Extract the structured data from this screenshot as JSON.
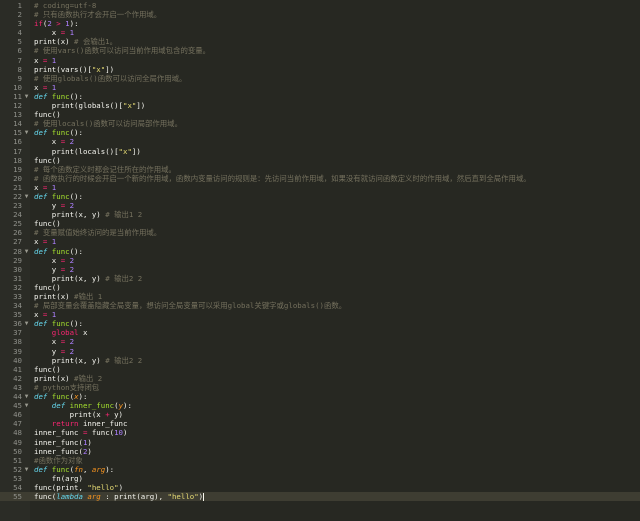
{
  "lines": [
    {
      "n": "1",
      "fold": "",
      "current": false,
      "t": [
        [
          "cm",
          "# coding=utf-8"
        ]
      ]
    },
    {
      "n": "2",
      "fold": "",
      "current": false,
      "t": [
        [
          "cm",
          "# 只有函数执行才会开启一个作用域。"
        ]
      ]
    },
    {
      "n": "3",
      "fold": "",
      "current": false,
      "t": [
        [
          "kw",
          "if"
        ],
        [
          "",
          "("
        ],
        [
          "nb",
          "2"
        ],
        [
          "kw",
          " > "
        ],
        [
          "nb",
          "1"
        ],
        [
          "",
          "):"
        ]
      ]
    },
    {
      "n": "4",
      "fold": "",
      "current": false,
      "t": [
        [
          "",
          "    x "
        ],
        [
          "kw",
          "="
        ],
        [
          "nb",
          " 1"
        ]
      ]
    },
    {
      "n": "5",
      "fold": "",
      "current": false,
      "t": [
        [
          "",
          "print(x) "
        ],
        [
          "cm",
          "# 会输出1。"
        ]
      ]
    },
    {
      "n": "6",
      "fold": "",
      "current": false,
      "t": [
        [
          "cm",
          "# 使用vars()函数可以访问当前作用域包含的变量。"
        ]
      ]
    },
    {
      "n": "7",
      "fold": "",
      "current": false,
      "t": [
        [
          "",
          "x "
        ],
        [
          "kw",
          "="
        ],
        [
          "nb",
          " 1"
        ]
      ]
    },
    {
      "n": "8",
      "fold": "",
      "current": false,
      "t": [
        [
          "",
          "print(vars()["
        ],
        [
          "st",
          "\"x\""
        ],
        [
          "",
          "])"
        ]
      ]
    },
    {
      "n": "9",
      "fold": "",
      "current": false,
      "t": [
        [
          "cm",
          "# 使用globals()函数可以访问全局作用域。"
        ]
      ]
    },
    {
      "n": "10",
      "fold": "",
      "current": false,
      "t": [
        [
          "",
          "x "
        ],
        [
          "kw",
          "="
        ],
        [
          "nb",
          " 1"
        ]
      ]
    },
    {
      "n": "11",
      "fold": "▼",
      "current": false,
      "t": [
        [
          "df",
          "def"
        ],
        [
          "fn",
          " func"
        ],
        [
          "",
          "():"
        ]
      ]
    },
    {
      "n": "12",
      "fold": "",
      "current": false,
      "t": [
        [
          "",
          "    print(globals()["
        ],
        [
          "st",
          "\"x\""
        ],
        [
          "",
          "])"
        ]
      ]
    },
    {
      "n": "13",
      "fold": "",
      "current": false,
      "t": [
        [
          "",
          "func()"
        ]
      ]
    },
    {
      "n": "14",
      "fold": "",
      "current": false,
      "t": [
        [
          "cm",
          "# 使用locals()函数可以访问局部作用域。"
        ]
      ]
    },
    {
      "n": "15",
      "fold": "▼",
      "current": false,
      "t": [
        [
          "df",
          "def"
        ],
        [
          "fn",
          " func"
        ],
        [
          "",
          "():"
        ]
      ]
    },
    {
      "n": "16",
      "fold": "",
      "current": false,
      "t": [
        [
          "",
          "    x "
        ],
        [
          "kw",
          "="
        ],
        [
          "nb",
          " 2"
        ]
      ]
    },
    {
      "n": "17",
      "fold": "",
      "current": false,
      "t": [
        [
          "",
          "    print(locals()["
        ],
        [
          "st",
          "\"x\""
        ],
        [
          "",
          "])"
        ]
      ]
    },
    {
      "n": "18",
      "fold": "",
      "current": false,
      "t": [
        [
          "",
          "func()"
        ]
      ]
    },
    {
      "n": "19",
      "fold": "",
      "current": false,
      "t": [
        [
          "cm",
          "# 每个函数定义时都会记住所在的作用域。"
        ]
      ]
    },
    {
      "n": "20",
      "fold": "",
      "current": false,
      "t": [
        [
          "cm",
          "# 函数执行的时候会开启一个新的作用域，函数内变量访问的规则是：先访问当前作用域，如果没有就访问函数定义时的作用域，然后直到全局作用域。"
        ]
      ]
    },
    {
      "n": "21",
      "fold": "",
      "current": false,
      "t": [
        [
          "",
          "x "
        ],
        [
          "kw",
          "="
        ],
        [
          "nb",
          " 1"
        ]
      ]
    },
    {
      "n": "22",
      "fold": "▼",
      "current": false,
      "t": [
        [
          "df",
          "def"
        ],
        [
          "fn",
          " func"
        ],
        [
          "",
          "():"
        ]
      ]
    },
    {
      "n": "23",
      "fold": "",
      "current": false,
      "t": [
        [
          "",
          "    y "
        ],
        [
          "kw",
          "="
        ],
        [
          "nb",
          " 2"
        ]
      ]
    },
    {
      "n": "24",
      "fold": "",
      "current": false,
      "t": [
        [
          "",
          "    print(x, y) "
        ],
        [
          "cm",
          "# 输出1 2"
        ]
      ]
    },
    {
      "n": "25",
      "fold": "",
      "current": false,
      "t": [
        [
          "",
          "func()"
        ]
      ]
    },
    {
      "n": "26",
      "fold": "",
      "current": false,
      "t": [
        [
          "cm",
          "# 变量赋值始终访问的是当前作用域。"
        ]
      ]
    },
    {
      "n": "27",
      "fold": "",
      "current": false,
      "t": [
        [
          "",
          "x "
        ],
        [
          "kw",
          "="
        ],
        [
          "nb",
          " 1"
        ]
      ]
    },
    {
      "n": "28",
      "fold": "▼",
      "current": false,
      "t": [
        [
          "df",
          "def"
        ],
        [
          "fn",
          " func"
        ],
        [
          "",
          "():"
        ]
      ]
    },
    {
      "n": "29",
      "fold": "",
      "current": false,
      "t": [
        [
          "",
          "    x "
        ],
        [
          "kw",
          "="
        ],
        [
          "nb",
          " 2"
        ]
      ]
    },
    {
      "n": "30",
      "fold": "",
      "current": false,
      "t": [
        [
          "",
          "    y "
        ],
        [
          "kw",
          "="
        ],
        [
          "nb",
          " 2"
        ]
      ]
    },
    {
      "n": "31",
      "fold": "",
      "current": false,
      "t": [
        [
          "",
          "    print(x, y) "
        ],
        [
          "cm",
          "# 输出2 2"
        ]
      ]
    },
    {
      "n": "32",
      "fold": "",
      "current": false,
      "t": [
        [
          "",
          "func()"
        ]
      ]
    },
    {
      "n": "33",
      "fold": "",
      "current": false,
      "t": [
        [
          "",
          "print(x) "
        ],
        [
          "cm",
          "#输出 1"
        ]
      ]
    },
    {
      "n": "34",
      "fold": "",
      "current": false,
      "t": [
        [
          "cm",
          "# 局部变量会覆盖隐藏全局变量，想访问全局变量可以采用global关键字或globals()函数。"
        ]
      ]
    },
    {
      "n": "35",
      "fold": "",
      "current": false,
      "t": [
        [
          "",
          "x "
        ],
        [
          "kw",
          "="
        ],
        [
          "nb",
          " 1"
        ]
      ]
    },
    {
      "n": "36",
      "fold": "▼",
      "current": false,
      "t": [
        [
          "df",
          "def"
        ],
        [
          "fn",
          " func"
        ],
        [
          "",
          "():"
        ]
      ]
    },
    {
      "n": "37",
      "fold": "",
      "current": false,
      "t": [
        [
          "kw",
          "    global"
        ],
        [
          "",
          " x"
        ]
      ]
    },
    {
      "n": "38",
      "fold": "",
      "current": false,
      "t": [
        [
          "",
          "    x "
        ],
        [
          "kw",
          "="
        ],
        [
          "nb",
          " 2"
        ]
      ]
    },
    {
      "n": "39",
      "fold": "",
      "current": false,
      "t": [
        [
          "",
          "    y "
        ],
        [
          "kw",
          "="
        ],
        [
          "nb",
          " 2"
        ]
      ]
    },
    {
      "n": "40",
      "fold": "",
      "current": false,
      "t": [
        [
          "",
          "    print(x, y) "
        ],
        [
          "cm",
          "# 输出2 2"
        ]
      ]
    },
    {
      "n": "41",
      "fold": "",
      "current": false,
      "t": [
        [
          "",
          "func()"
        ]
      ]
    },
    {
      "n": "42",
      "fold": "",
      "current": false,
      "t": [
        [
          "",
          "print(x) "
        ],
        [
          "cm",
          "#输出 2"
        ]
      ]
    },
    {
      "n": "43",
      "fold": "",
      "current": false,
      "t": [
        [
          "cm",
          "# python支持闭包"
        ]
      ]
    },
    {
      "n": "44",
      "fold": "▼",
      "current": false,
      "t": [
        [
          "df",
          "def"
        ],
        [
          "fn",
          " func"
        ],
        [
          "",
          "("
        ],
        [
          "pa",
          "x"
        ],
        [
          "",
          "):"
        ]
      ]
    },
    {
      "n": "45",
      "fold": "▼",
      "current": false,
      "t": [
        [
          "df",
          "    def"
        ],
        [
          "fn",
          " inner_func"
        ],
        [
          "",
          "("
        ],
        [
          "pa",
          "y"
        ],
        [
          "",
          "):"
        ]
      ]
    },
    {
      "n": "46",
      "fold": "",
      "current": false,
      "t": [
        [
          "",
          "        print(x "
        ],
        [
          "kw",
          "+"
        ],
        [
          "",
          " y)"
        ]
      ]
    },
    {
      "n": "47",
      "fold": "",
      "current": false,
      "t": [
        [
          "kw",
          "    return"
        ],
        [
          "",
          " inner_func"
        ]
      ]
    },
    {
      "n": "48",
      "fold": "",
      "current": false,
      "t": [
        [
          "",
          "inner_func "
        ],
        [
          "kw",
          "="
        ],
        [
          "",
          " func("
        ],
        [
          "nb",
          "10"
        ],
        [
          "",
          ")"
        ]
      ]
    },
    {
      "n": "49",
      "fold": "",
      "current": false,
      "t": [
        [
          "",
          "inner_func("
        ],
        [
          "nb",
          "1"
        ],
        [
          "",
          ")"
        ]
      ]
    },
    {
      "n": "50",
      "fold": "",
      "current": false,
      "t": [
        [
          "",
          "inner_func("
        ],
        [
          "nb",
          "2"
        ],
        [
          "",
          ")"
        ]
      ]
    },
    {
      "n": "51",
      "fold": "",
      "current": false,
      "t": [
        [
          "cm",
          "#函数作为对象"
        ]
      ]
    },
    {
      "n": "52",
      "fold": "▼",
      "current": false,
      "t": [
        [
          "df",
          "def"
        ],
        [
          "fn",
          " func"
        ],
        [
          "",
          "("
        ],
        [
          "pa",
          "fn"
        ],
        [
          "",
          ", "
        ],
        [
          "pa",
          "arg"
        ],
        [
          "",
          "):"
        ]
      ]
    },
    {
      "n": "53",
      "fold": "",
      "current": false,
      "t": [
        [
          "",
          "    fn(arg)"
        ]
      ]
    },
    {
      "n": "54",
      "fold": "",
      "current": false,
      "t": [
        [
          "",
          "func(print, "
        ],
        [
          "st",
          "\"hello\""
        ],
        [
          "",
          ")"
        ]
      ]
    },
    {
      "n": "55",
      "fold": "",
      "current": true,
      "t": [
        [
          "",
          "func("
        ],
        [
          "df",
          "lambda"
        ],
        [
          "pa",
          " arg"
        ],
        [
          "",
          " : print(arg), "
        ],
        [
          "st",
          "\"hello\""
        ],
        [
          "",
          ")"
        ]
      ]
    }
  ]
}
